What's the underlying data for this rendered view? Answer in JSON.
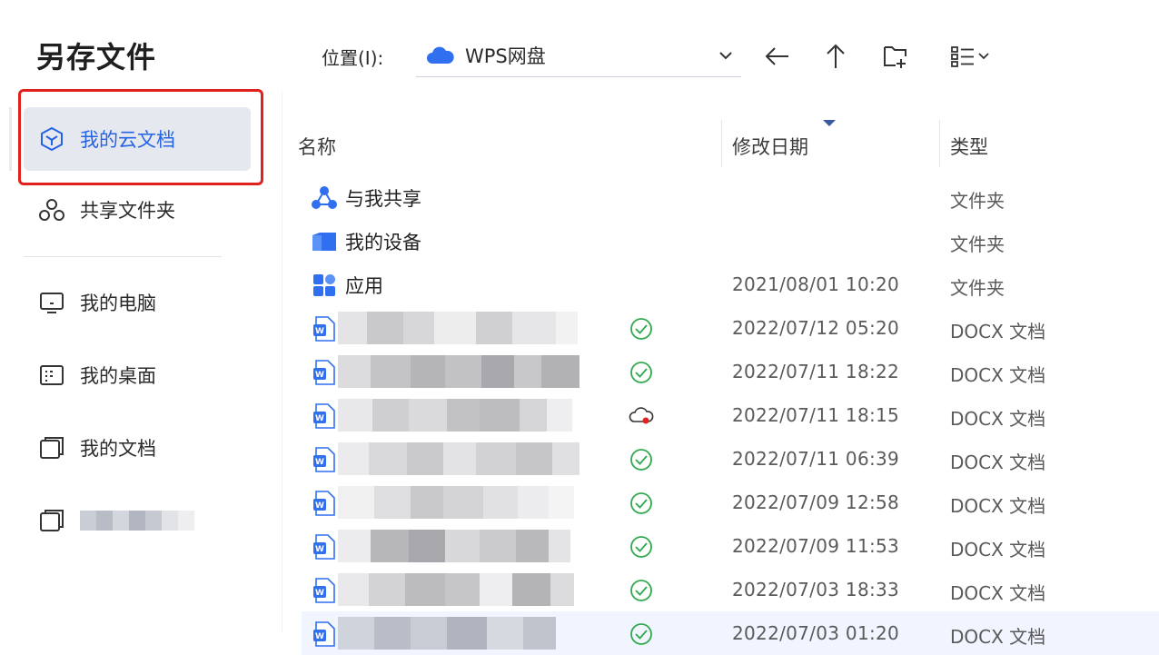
{
  "dialog": {
    "title": "另存文件"
  },
  "sidebar": {
    "items": [
      {
        "label": "我的云文档",
        "icon": "cloud-doc-icon",
        "active": true
      },
      {
        "label": "共享文件夹",
        "icon": "share-folder-icon"
      },
      {
        "label": "我的电脑",
        "icon": "computer-icon"
      },
      {
        "label": "我的桌面",
        "icon": "desktop-icon"
      },
      {
        "label": "我的文档",
        "icon": "documents-icon"
      }
    ]
  },
  "toolbar": {
    "location_label": "位置(I):",
    "location_value": "WPS网盘",
    "location_icon": "cloud-icon",
    "back_icon": "arrow-left-icon",
    "up_icon": "arrow-up-icon",
    "new_folder_icon": "new-folder-icon",
    "view_icon": "list-view-icon"
  },
  "columns": {
    "name": "名称",
    "date": "修改日期",
    "type": "类型"
  },
  "rows": [
    {
      "name": "与我共享",
      "date": "",
      "type": "文件夹",
      "icon": "shared-icon"
    },
    {
      "name": "我的设备",
      "date": "",
      "type": "文件夹",
      "icon": "device-folder-icon"
    },
    {
      "name": "应用",
      "date": "2021/08/01 10:20",
      "type": "文件夹",
      "icon": "apps-icon"
    },
    {
      "name": "",
      "date": "2022/07/12 05:20",
      "type": "DOCX 文档",
      "icon": "docx-icon",
      "status": "synced"
    },
    {
      "name": "",
      "date": "2022/07/11 18:22",
      "type": "DOCX 文档",
      "icon": "docx-icon",
      "status": "synced"
    },
    {
      "name": "",
      "date": "2022/07/11 18:15",
      "type": "DOCX 文档",
      "icon": "docx-icon",
      "status": "cloud-pending"
    },
    {
      "name": "",
      "date": "2022/07/11 06:39",
      "type": "DOCX 文档",
      "icon": "docx-icon",
      "status": "synced"
    },
    {
      "name": "",
      "date": "2022/07/09 12:58",
      "type": "DOCX 文档",
      "icon": "docx-icon",
      "status": "synced"
    },
    {
      "name": "",
      "date": "2022/07/09 11:53",
      "type": "DOCX 文档",
      "icon": "docx-icon",
      "status": "synced"
    },
    {
      "name": "",
      "date": "2022/07/03 18:33",
      "type": "DOCX 文档",
      "icon": "docx-icon",
      "status": "synced"
    },
    {
      "name": "",
      "date": "2022/07/03 01:20",
      "type": "DOCX 文档",
      "icon": "docx-icon",
      "status": "synced"
    }
  ],
  "colors": {
    "accent": "#2463e6",
    "highlight": "#e0211d",
    "status_ok": "#2fa84f",
    "status_pending": "#e0211d"
  }
}
